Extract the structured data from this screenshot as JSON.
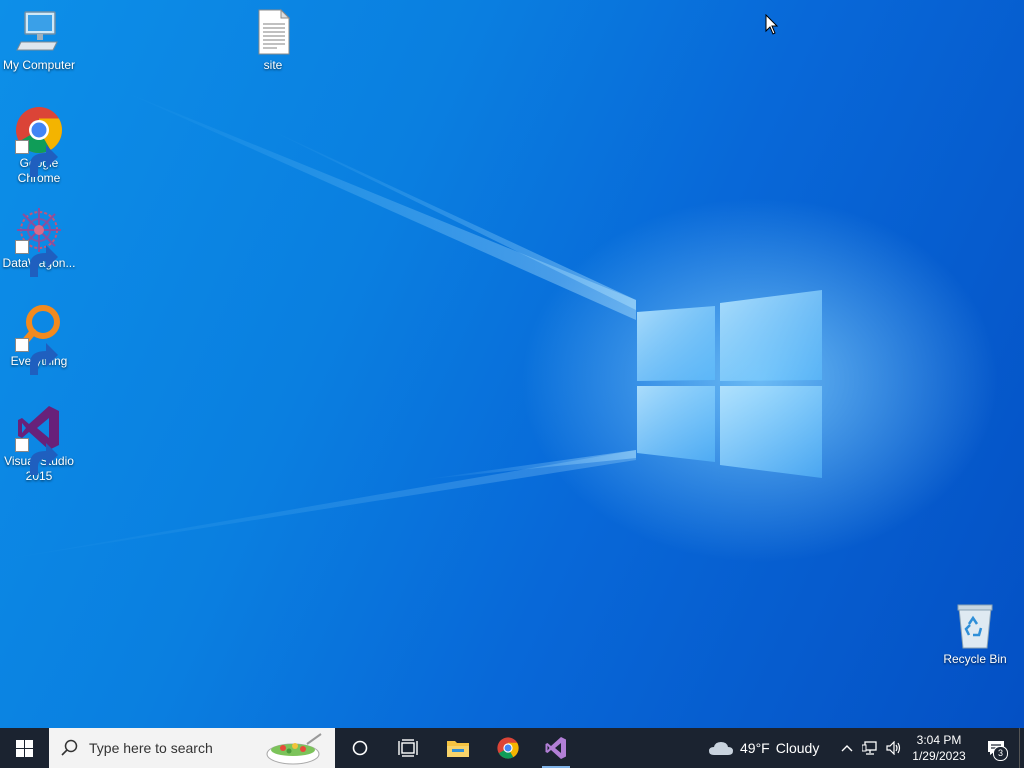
{
  "desktop": {
    "icons": [
      {
        "label": "My Computer",
        "icon": "computer-icon"
      },
      {
        "label": "site",
        "icon": "text-file-icon"
      },
      {
        "label": "Google Chrome",
        "icon": "chrome-icon",
        "shortcut": true
      },
      {
        "label": "DataWagon...",
        "icon": "datawagon-icon",
        "shortcut": true
      },
      {
        "label": "Everything",
        "icon": "everything-search-icon",
        "shortcut": true
      },
      {
        "label": "Visual Studio 2015",
        "icon": "visual-studio-icon",
        "shortcut": true
      },
      {
        "label": "Recycle Bin",
        "icon": "recycle-bin-icon"
      }
    ]
  },
  "taskbar": {
    "search_placeholder": "Type here to search",
    "apps": [
      {
        "name": "File Explorer",
        "icon": "folder-icon"
      },
      {
        "name": "Google Chrome",
        "icon": "chrome-icon"
      },
      {
        "name": "Visual Studio 2015",
        "icon": "visual-studio-icon"
      }
    ],
    "weather": {
      "temp": "49°F",
      "condition": "Cloudy",
      "icon": "cloud-icon"
    },
    "clock": {
      "time": "3:04 PM",
      "date": "1/29/2023"
    },
    "notifications": {
      "count": "3"
    }
  },
  "colors": {
    "taskbar": "#1b2330",
    "desktop_accent": "#0a7fe0",
    "visual_studio": "#68217a",
    "everything": "#f28a1e"
  }
}
